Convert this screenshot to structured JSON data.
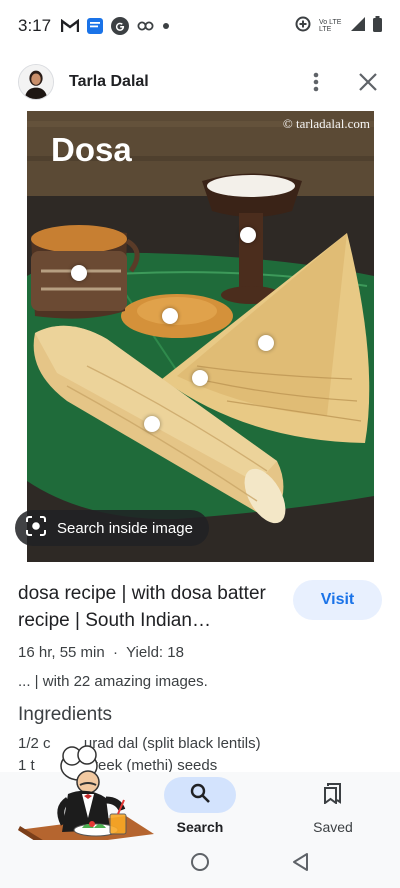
{
  "status_bar": {
    "time": "3:17",
    "left_icons": [
      "gmail-icon",
      "messages-icon",
      "google-icon",
      "link-icon",
      "dot-icon"
    ],
    "right_icons": [
      "data-saver-icon",
      "vowifi-lte-icon",
      "signal-icon",
      "battery-icon"
    ],
    "network_text": "Vo LTE LTE"
  },
  "header": {
    "title": "Tarla Dalal",
    "actions": [
      "more-vert-icon",
      "close-icon"
    ]
  },
  "image": {
    "title": "Dosa",
    "watermark": "© tarladalal.com",
    "lens_label": "Search inside image",
    "dots_count": 6
  },
  "result": {
    "title": "dosa recipe | with dosa batter recipe | South Indian…",
    "visit_label": "Visit",
    "meta": "16 hr, 55 min  ·  Yield: 18",
    "snippet": "... | with 22 amazing images.",
    "section_title": "Ingredients",
    "ingredients": [
      "1/2 c        urad dal (split black lentils)",
      "1 t              reek (methi) seeds"
    ]
  },
  "bottom_nav": {
    "search_label": "Search",
    "saved_label": "Saved"
  },
  "colors": {
    "accent": "#1a73e8",
    "visit_bg": "#e8f0fe",
    "nav_pill": "#d3e3fd"
  }
}
